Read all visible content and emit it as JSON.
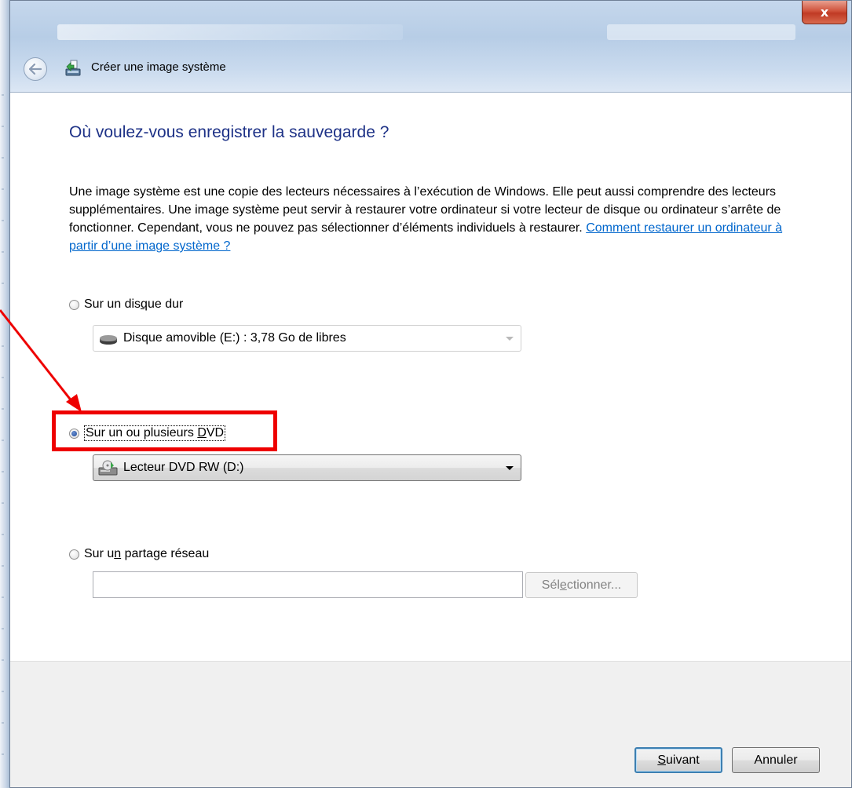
{
  "window": {
    "title": "Créer une image système",
    "close_glyph": "x"
  },
  "page": {
    "heading": "Où voulez-vous enregistrer la sauvegarde ?",
    "description": "Une image système est une copie des lecteurs nécessaires à l’exécution de Windows. Elle peut aussi comprendre des lecteurs supplémentaires. Une image système peut servir à restaurer votre ordinateur si votre lecteur de disque ou ordinateur s’arrête de fonctionner. Cependant, vous ne pouvez pas sélectionner d’éléments individuels à restaurer. ",
    "help_link": "Comment restaurer un ordinateur à partir d’une image système ?"
  },
  "options": {
    "hard_disk": {
      "label_pre": "Sur un dis",
      "label_accel": "q",
      "label_post": "ue dur",
      "selected": false,
      "combo_value": "Disque amovible (E:) : 3,78 Go de libres",
      "combo_enabled": false
    },
    "dvd": {
      "label_pre": "Sur un ou plusieurs ",
      "label_accel": "D",
      "label_post": "VD",
      "selected": true,
      "combo_value": "Lecteur DVD RW (D:)",
      "combo_enabled": true
    },
    "network": {
      "label_pre": "Sur u",
      "label_accel": "n",
      "label_post": " partage réseau",
      "selected": false,
      "input_value": "",
      "select_pre": "Sél",
      "select_accel": "e",
      "select_post": "ctionner..."
    }
  },
  "footer": {
    "next_accel": "S",
    "next_post": "uivant",
    "cancel": "Annuler"
  },
  "colors": {
    "heading": "#1e3287",
    "link": "#0066cc",
    "annotation": "#ee0000"
  }
}
